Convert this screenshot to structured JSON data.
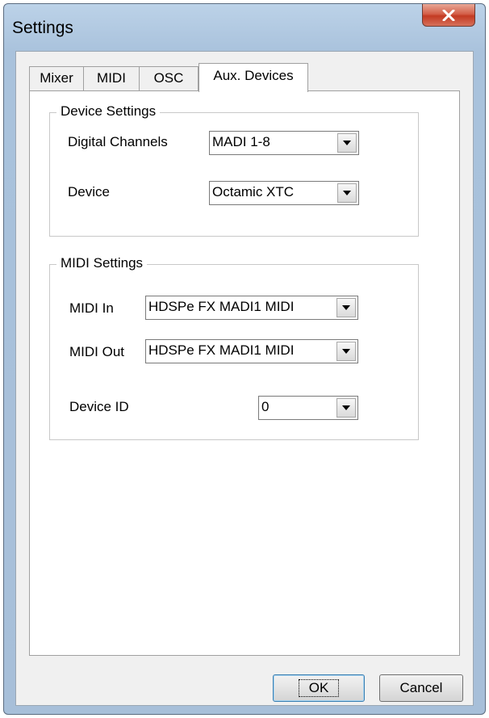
{
  "window": {
    "title": "Settings",
    "close_icon": "close-icon"
  },
  "tabs": [
    {
      "label": "Mixer",
      "active": false
    },
    {
      "label": "MIDI",
      "active": false
    },
    {
      "label": "OSC",
      "active": false
    },
    {
      "label": "Aux. Devices",
      "active": true
    }
  ],
  "device_settings": {
    "title": "Device Settings",
    "digital_channels": {
      "label": "Digital Channels",
      "value": "MADI 1-8"
    },
    "device": {
      "label": "Device",
      "value": "Octamic XTC"
    }
  },
  "midi_settings": {
    "title": "MIDI Settings",
    "midi_in": {
      "label": "MIDI In",
      "value": "HDSPe FX MADI1 MIDI"
    },
    "midi_out": {
      "label": "MIDI Out",
      "value": "HDSPe FX MADI1 MIDI"
    },
    "device_id": {
      "label": "Device ID",
      "value": "0"
    }
  },
  "buttons": {
    "ok": "OK",
    "cancel": "Cancel"
  },
  "colors": {
    "frame": "#a9c2dc",
    "close_button": "#c33a22",
    "dialog_bg": "#f0f0f0"
  }
}
